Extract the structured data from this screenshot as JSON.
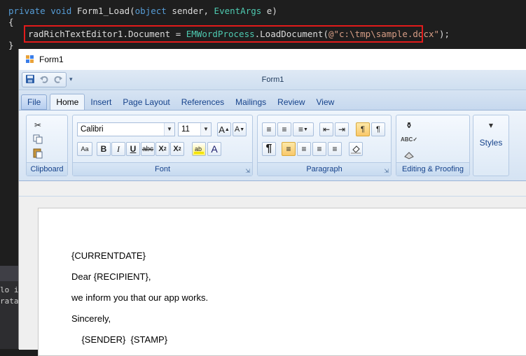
{
  "code": {
    "line1": {
      "kw1": "private",
      "kw2": "void",
      "name": "Form1_Load(",
      "kw3": "object",
      "param1": " sender, ",
      "type1": "EventArgs",
      "param2": " e)"
    },
    "line2": "{",
    "line3": {
      "pre": "radRichTextEditor1.Document = ",
      "type": "EMWordProcess",
      "mid": ".LoadDocument(",
      "str": "@\"c:\\tmp\\sample.docx\"",
      "end": ");"
    },
    "line4": "}",
    "side_lines": [
      "lo im",
      "rata"
    ]
  },
  "window": {
    "title": "Form1",
    "qat_title": "Form1",
    "qat_icons": [
      "save-icon",
      "undo-icon",
      "redo-icon"
    ]
  },
  "tabs": [
    "File",
    "Home",
    "Insert",
    "Page Layout",
    "References",
    "Mailings",
    "Review",
    "View"
  ],
  "active_tab": "Home",
  "ribbon": {
    "clipboard": {
      "label": "Clipboard"
    },
    "font": {
      "label": "Font",
      "family": "Calibri",
      "size": "11"
    },
    "paragraph": {
      "label": "Paragraph"
    },
    "editing": {
      "label": "Editing & Proofing"
    },
    "styles": {
      "label": "Styles"
    }
  },
  "document": {
    "paragraphs": [
      "{CURRENTDATE}",
      "Dear {RECIPIENT},",
      "we inform you that our app works.",
      "Sincerely,",
      "    {SENDER}  {STAMP}"
    ]
  },
  "colors": {
    "highlight_border": "#e21b1b",
    "ribbon_text": "#15428b",
    "selected_button": "#f9c86a"
  }
}
